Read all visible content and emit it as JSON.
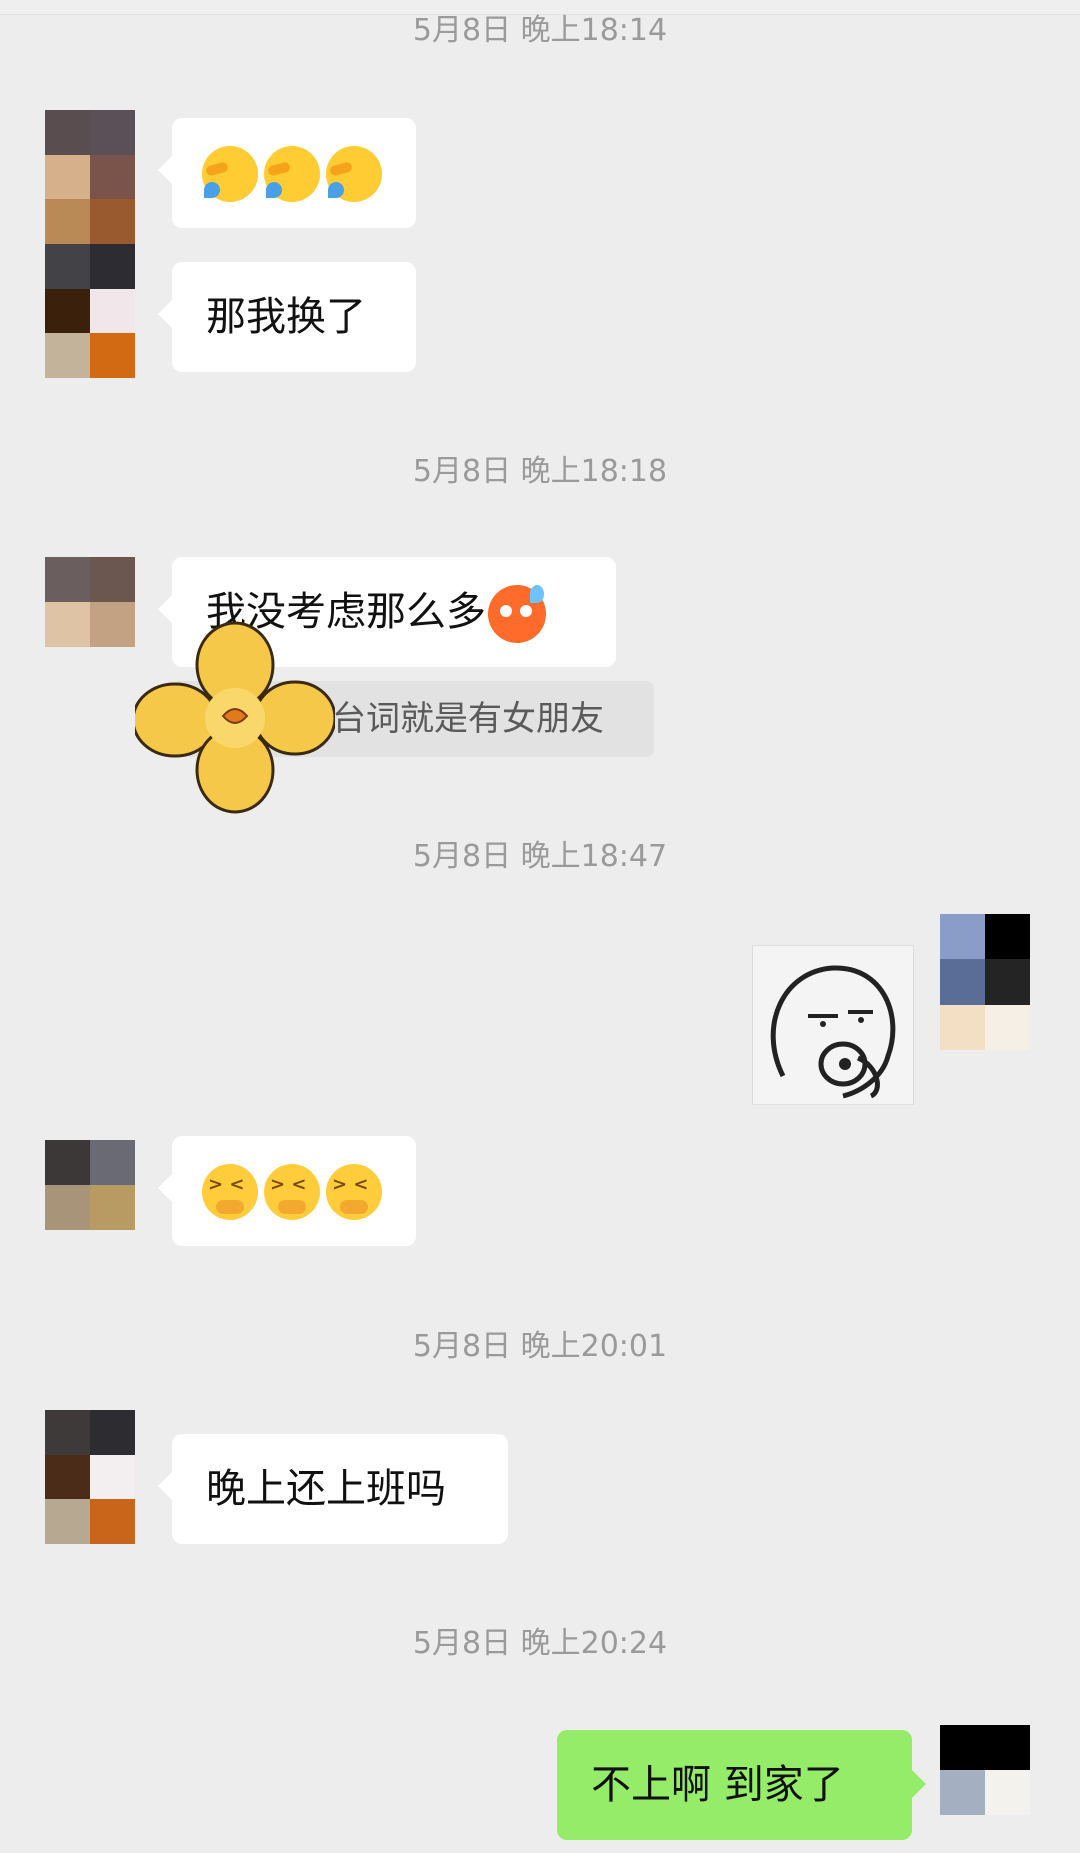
{
  "timestamps": [
    "5月8日 晚上18:14",
    "5月8日 晚上18:18",
    "5月8日 晚上18:47",
    "5月8日 晚上20:01",
    "5月8日 晚上20:24"
  ],
  "messages": {
    "m1_emojis": [
      "cry-face-icon",
      "cry-face-icon",
      "cry-face-icon"
    ],
    "m2": "那我换了",
    "m3": "我没考虑那么多",
    "quote": "台词就是有女朋友",
    "m5_emojis": [
      "nauseated-face-icon",
      "nauseated-face-icon",
      "nauseated-face-icon"
    ],
    "m6": "晚上还上班吗",
    "m7": "不上啊 到家了"
  },
  "colors": {
    "background": "#ededed",
    "bubble_in": "#ffffff",
    "bubble_out": "#95ec69",
    "timestamp": "#9a9a9a"
  },
  "avatars": {
    "friend_a": [
      "#5a4d4f",
      "#5c5058",
      "#d6b08a",
      "#7a544a",
      "#b98a55",
      "#9a5a30",
      "#434246",
      "#2d2c33",
      "#3b200c",
      "#f1e6ea",
      "#c2b39a",
      "#d26a14"
    ],
    "friend_b": [
      "#6a5e5e",
      "#6b5650",
      "#dfc3a5",
      "#c3a283"
    ],
    "me": [
      "#8a9cc8",
      "#000000",
      "#5a6d96",
      "#242424",
      "#f3dfc4",
      "#f6efe6"
    ],
    "friend_c": [
      "#3c3838",
      "#6a6a74",
      "#a79479",
      "#b89b62"
    ],
    "friend_d": [
      "#3e3a3a",
      "#2d2c30",
      "#4b2c18",
      "#f3eef0",
      "#b7a891",
      "#c9651a"
    ],
    "me2": [
      "#000000",
      "#000000",
      "#a4b0c2",
      "#f4f2ec"
    ]
  }
}
